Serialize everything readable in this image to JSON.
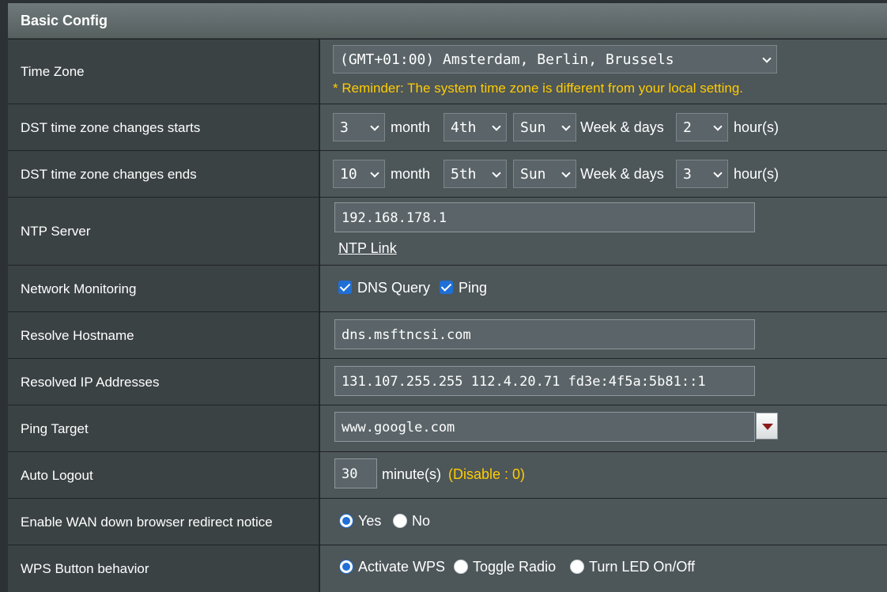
{
  "header": {
    "title": "Basic Config"
  },
  "time_zone": {
    "label": "Time Zone",
    "selected": "(GMT+01:00) Amsterdam, Berlin, Brussels",
    "reminder": "* Reminder: The system time zone is different from your local setting."
  },
  "dst_start": {
    "label": "DST time zone changes starts",
    "month_value": "3",
    "month_text": "month",
    "week_value": "4th",
    "day_value": "Sun",
    "weekdays_text": "Week & days",
    "hour_value": "2",
    "hour_text": "hour(s)"
  },
  "dst_end": {
    "label": "DST time zone changes ends",
    "month_value": "10",
    "month_text": "month",
    "week_value": "5th",
    "day_value": "Sun",
    "weekdays_text": "Week & days",
    "hour_value": "3",
    "hour_text": "hour(s)"
  },
  "ntp": {
    "label": "NTP Server",
    "value": "192.168.178.1",
    "link": "NTP Link"
  },
  "network_monitoring": {
    "label": "Network Monitoring",
    "dns_query": "DNS Query",
    "dns_checked": true,
    "ping": "Ping",
    "ping_checked": true
  },
  "resolve_hostname": {
    "label": "Resolve Hostname",
    "value": "dns.msftncsi.com"
  },
  "resolved_ip": {
    "label": "Resolved IP Addresses",
    "value": "131.107.255.255 112.4.20.71 fd3e:4f5a:5b81::1"
  },
  "ping_target": {
    "label": "Ping Target",
    "value": "www.google.com"
  },
  "auto_logout": {
    "label": "Auto Logout",
    "value": "30",
    "unit": "minute(s)",
    "note": "(Disable : 0)"
  },
  "wan_redirect": {
    "label": "Enable WAN down browser redirect notice",
    "yes": "Yes",
    "no": "No",
    "selected": "Yes"
  },
  "wps": {
    "label": "WPS Button behavior",
    "opt1": "Activate WPS",
    "opt2": "Toggle Radio",
    "opt3": "Turn LED On/Off",
    "selected": "Activate WPS"
  },
  "colors": {
    "reminder": "#ffcc00",
    "accent": "#1f6fd6",
    "header_bg": "#6f797c"
  },
  "icons": [
    "chevron-down-icon",
    "checkbox-checked-icon",
    "radio-icon",
    "dropdown-arrow-icon"
  ]
}
